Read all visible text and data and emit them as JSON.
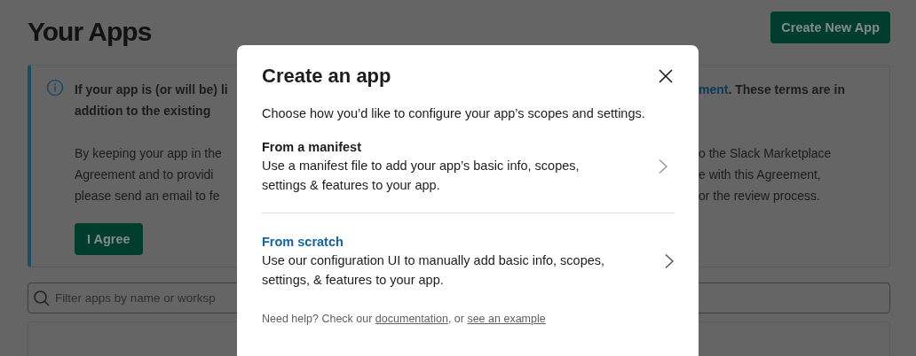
{
  "page": {
    "title": "Your Apps",
    "create_button": "Create New App"
  },
  "notice": {
    "paragraphs": [
      {
        "bold": true,
        "lines": [
          {
            "left": "If your app is (or will be) li",
            "right_link": "ment",
            "right": ". These terms are in"
          },
          {
            "left": "addition to the existing"
          }
        ]
      },
      {
        "bold": false,
        "lines": [
          {
            "left": "By keeping your app in the",
            "right": "o the Slack Marketplace"
          },
          {
            "left": "Agreement and to providi",
            "right": "e with this Agreement,"
          },
          {
            "left": "please send an email to fe",
            "right": "or the review process."
          }
        ]
      }
    ],
    "agree_button": "I Agree"
  },
  "search": {
    "placeholder": "Filter apps by name or worksp"
  },
  "modal": {
    "title": "Create an app",
    "description": "Choose how you’d like to configure your app’s scopes and settings.",
    "options": [
      {
        "title": "From a manifest",
        "hovered": false,
        "description_lines": [
          "Use a manifest file to add your app’s basic info, scopes,",
          "settings & features to your app."
        ]
      },
      {
        "title": "From scratch",
        "hovered": true,
        "description_lines": [
          "Use our configuration UI to manually add basic info, scopes,",
          "settings, & features to your app."
        ]
      }
    ],
    "help": [
      {
        "text": "Need help? Check our ",
        "link": false
      },
      {
        "text": "documentation",
        "link": true
      },
      {
        "text": ", or ",
        "link": false
      },
      {
        "text": "see an example",
        "link": true
      }
    ]
  }
}
